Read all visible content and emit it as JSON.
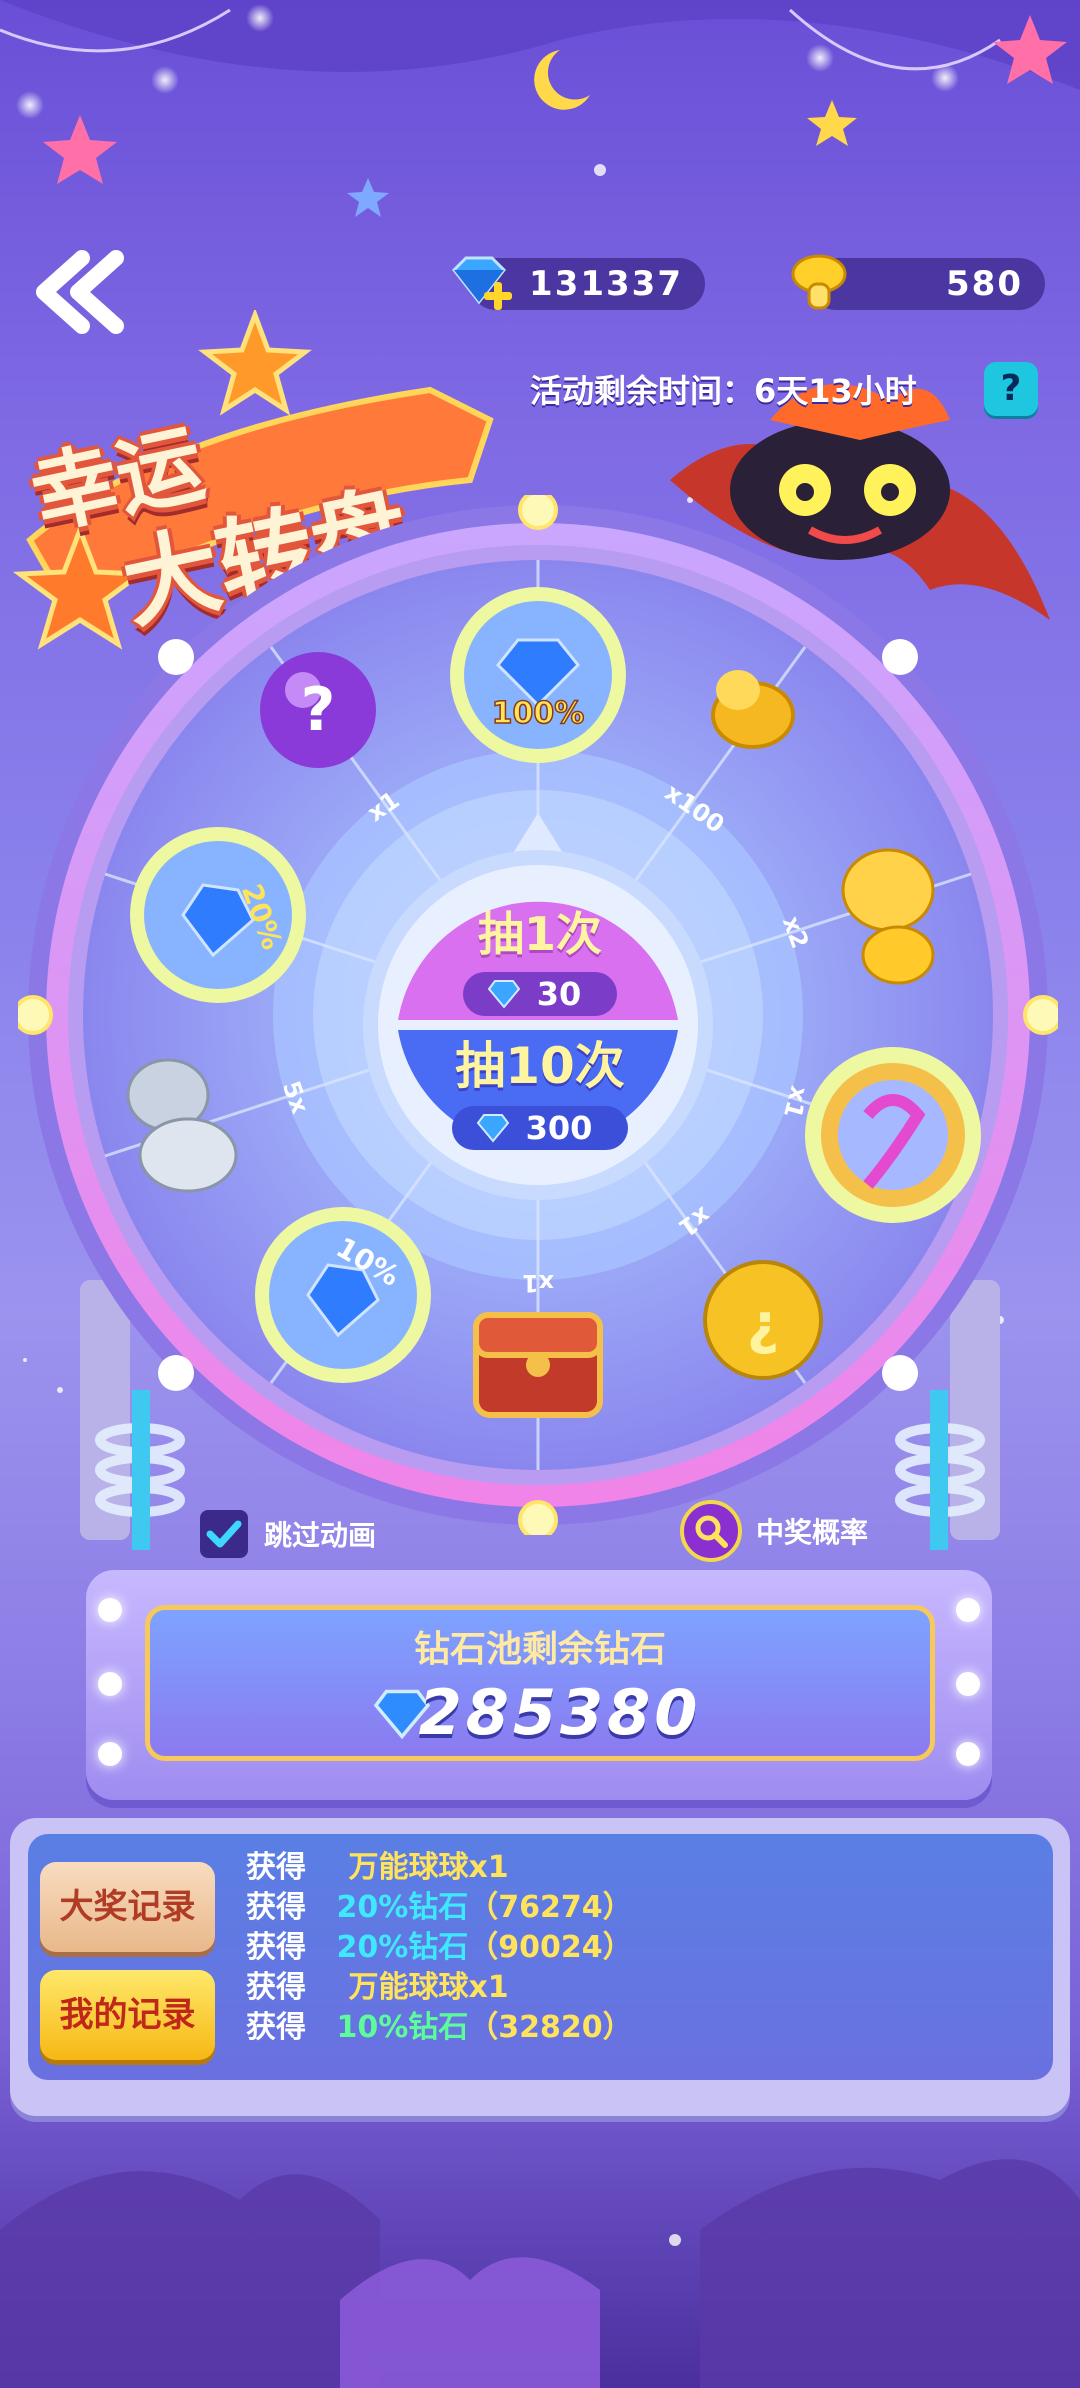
{
  "header": {
    "back_icon": "double-chevron-left-icon",
    "gems": "131337",
    "mushrooms": "580",
    "timer_text": "活动剩余时间：6天13小时",
    "help_label": "?"
  },
  "title": {
    "line1": "幸运",
    "line2": "大转盘"
  },
  "wheel": {
    "segments": [
      {
        "icon": "mystery-ball-icon",
        "multiplier": "x1"
      },
      {
        "icon": "gem-pile-100-icon",
        "multiplier": "",
        "badge": "100%"
      },
      {
        "icon": "gold-coins-icon",
        "multiplier": "x100"
      },
      {
        "icon": "golden-mushroom-icon",
        "multiplier": "x2"
      },
      {
        "icon": "star-orb-icon",
        "multiplier": "x1"
      },
      {
        "icon": "golden-egg-icon",
        "multiplier": "x1"
      },
      {
        "icon": "treasure-chest-icon",
        "multiplier": "x1"
      },
      {
        "icon": "gem-pile-10-icon",
        "multiplier": "",
        "badge": "10%"
      },
      {
        "icon": "silver-mushroom-icon",
        "multiplier": "5x"
      },
      {
        "icon": "gem-pile-20-icon",
        "multiplier": "",
        "badge": "20%"
      }
    ],
    "draw_once_label": "抽1次",
    "draw_once_cost": "30",
    "draw_ten_label": "抽10次",
    "draw_ten_cost": "300"
  },
  "options": {
    "skip_animation": "跳过动画",
    "skip_checked": true,
    "odds": "中奖概率"
  },
  "pool": {
    "title": "钻石池剩余钻石",
    "value": "285380"
  },
  "records": {
    "tab_grand": "大奖记录",
    "tab_mine": "我的记录",
    "items": [
      {
        "verb": "获得",
        "item": "万能球球x1",
        "color": "gold",
        "detail": ""
      },
      {
        "verb": "获得",
        "item": "20%钻石",
        "color": "cyan",
        "detail": "（76274）"
      },
      {
        "verb": "获得",
        "item": "20%钻石",
        "color": "cyan",
        "detail": "（90024）"
      },
      {
        "verb": "获得",
        "item": "万能球球x1",
        "color": "gold",
        "detail": ""
      },
      {
        "verb": "获得",
        "item": "10%钻石",
        "color": "green",
        "detail": "（32820）"
      }
    ]
  }
}
